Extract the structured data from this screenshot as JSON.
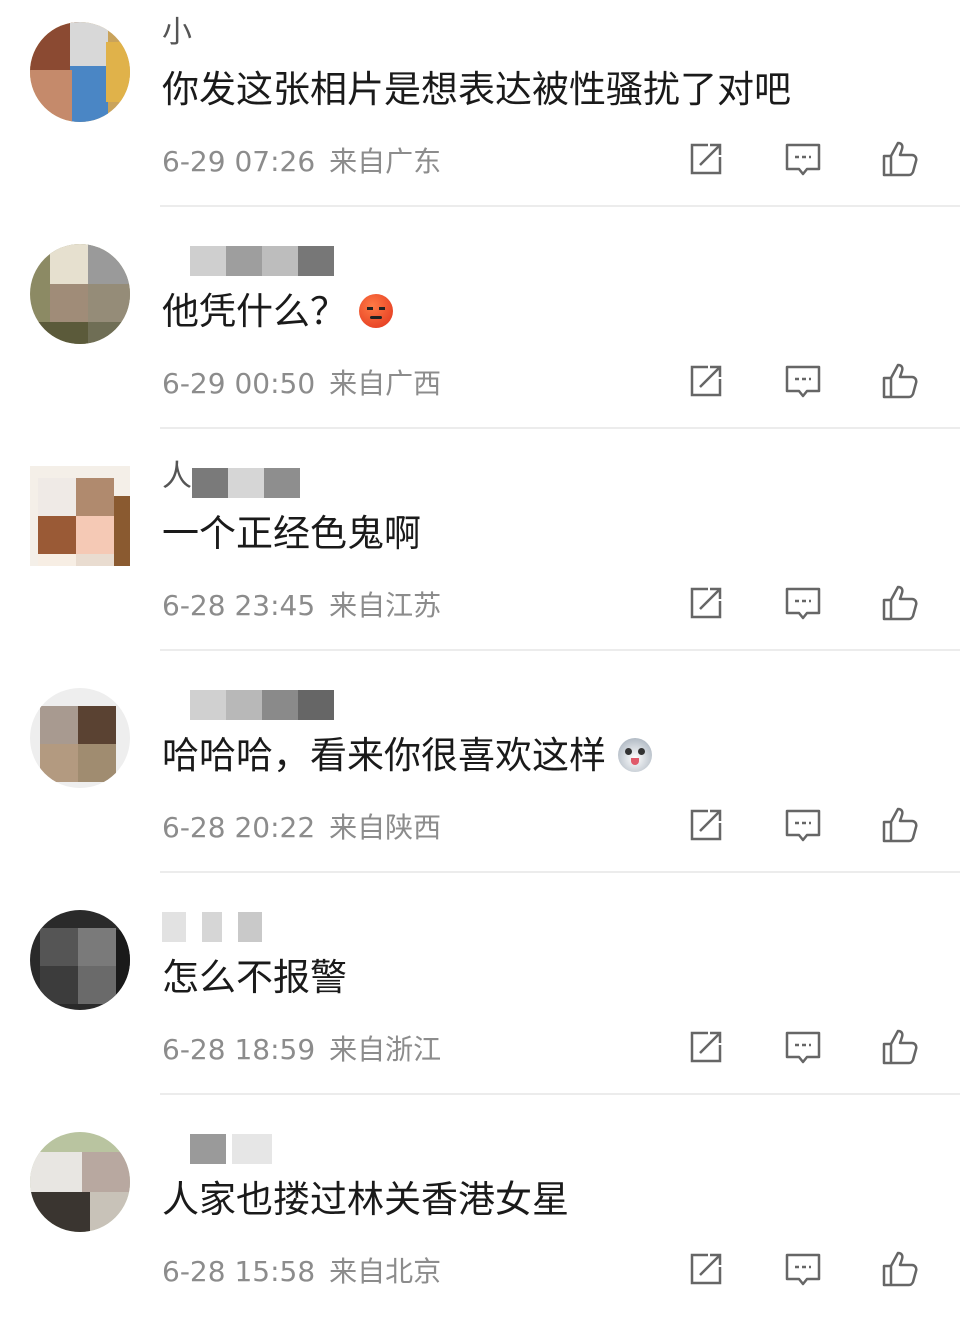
{
  "comments": [
    {
      "name_visible": "小",
      "text": "你发这张相片是想表达被性骚扰了对吧",
      "time": "6-29 07:26",
      "location": "来自广东",
      "emoji": ""
    },
    {
      "name_visible": "",
      "text": "他凭什么？",
      "time": "6-29 00:50",
      "location": "来自广西",
      "emoji": "angry-face"
    },
    {
      "name_visible": "人",
      "text": "一个正经色鬼啊",
      "time": "6-28 23:45",
      "location": "来自江苏",
      "emoji": ""
    },
    {
      "name_visible": "",
      "text": "哈哈哈，看来你很喜欢这样",
      "time": "6-28 20:22",
      "location": "来自陕西",
      "emoji": "husky-face"
    },
    {
      "name_visible": "",
      "text": "怎么不报警",
      "time": "6-28 18:59",
      "location": "来自浙江",
      "emoji": ""
    },
    {
      "name_visible": "",
      "text": "人家也搂过林关香港女星",
      "time": "6-28 15:58",
      "location": "来自北京",
      "emoji": ""
    }
  ],
  "icons": {
    "share": "share-icon",
    "reply": "reply-icon",
    "like": "thumbs-up-icon"
  },
  "colors": {
    "text": "#1a1a1a",
    "meta": "#8c8c8c",
    "icon": "#666666",
    "divider": "#ececec"
  }
}
